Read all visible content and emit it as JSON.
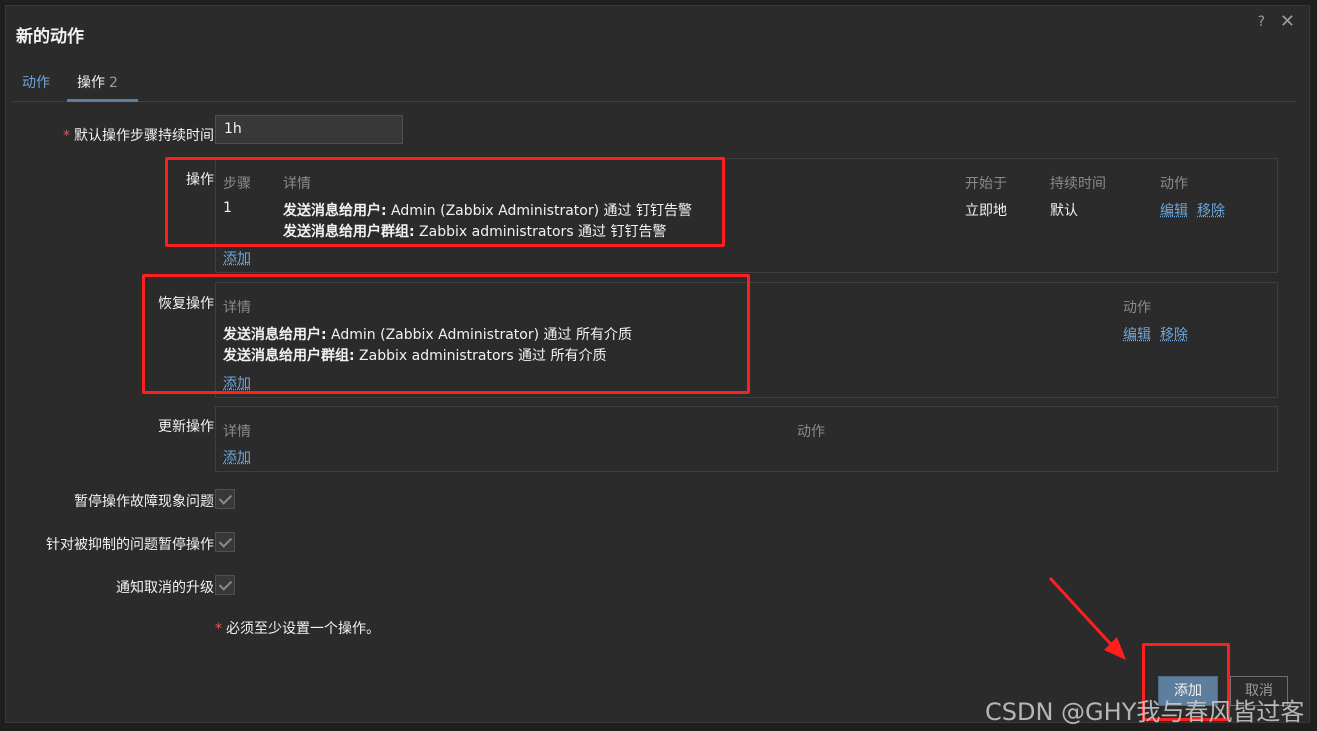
{
  "dialog": {
    "title": "新的动作",
    "help": "?",
    "close": "✕"
  },
  "tabs": [
    {
      "label": "动作"
    },
    {
      "label": "操作",
      "count": "2"
    }
  ],
  "form": {
    "default_duration": {
      "label": "默认操作步骤持续时间",
      "value": "1h"
    },
    "operations": {
      "label": "操作",
      "columns": {
        "step": "步骤",
        "details": "详情",
        "start": "开始于",
        "duration": "持续时间",
        "actions": "动作"
      },
      "rows": [
        {
          "step": "1",
          "line1_bold": "发送消息给用户:",
          "line1_text": " Admin (Zabbix Administrator) 通过 钉钉告警",
          "line2_bold": "发送消息给用户群组:",
          "line2_text": " Zabbix administrators 通过 钉钉告警",
          "start": "立即地",
          "duration": "默认",
          "edit": "编辑",
          "remove": "移除"
        }
      ],
      "add": "添加"
    },
    "recovery": {
      "label": "恢复操作",
      "columns": {
        "details": "详情",
        "actions": "动作"
      },
      "rows": [
        {
          "line1_bold": "发送消息给用户:",
          "line1_text": " Admin (Zabbix Administrator) 通过 所有介质",
          "line2_bold": "发送消息给用户群组:",
          "line2_text": " Zabbix administrators 通过 所有介质",
          "edit": "编辑",
          "remove": "移除"
        }
      ],
      "add": "添加"
    },
    "update": {
      "label": "更新操作",
      "columns": {
        "details": "详情",
        "actions": "动作"
      },
      "add": "添加"
    },
    "pause_suppressed": {
      "label": "暂停操作故障现象问题",
      "checked": true
    },
    "pause_symptoms": {
      "label": "针对被抑制的问题暂停操作",
      "checked": true
    },
    "notify_canceled": {
      "label": "通知取消的升级",
      "checked": true
    },
    "required_note": "必须至少设置一个操作。",
    "required_mark": "*"
  },
  "buttons": {
    "add": "添加",
    "cancel": "取消"
  },
  "watermark": "CSDN @GHY我与春风皆过客",
  "colors": {
    "accent": "#6ea5d8",
    "primary_button": "#5d7e9c",
    "highlight": "#ff1f1f",
    "background": "#2b2b2b"
  }
}
